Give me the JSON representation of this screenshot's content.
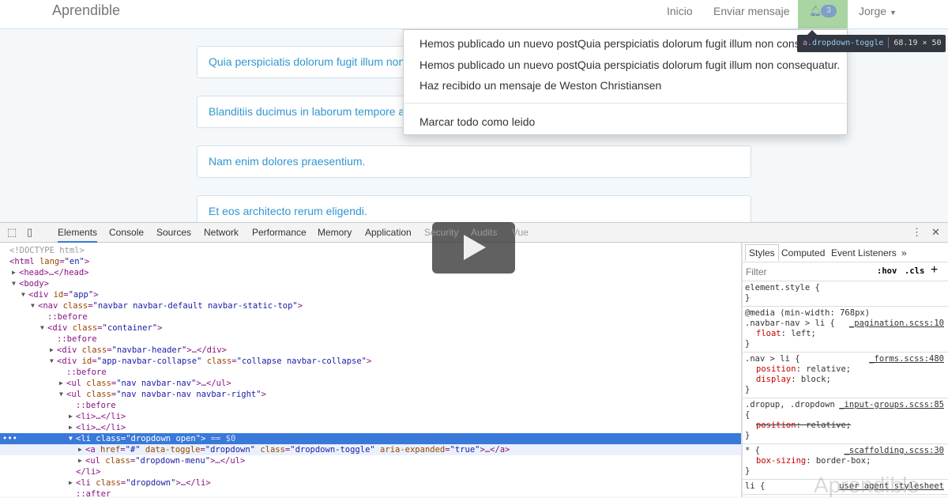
{
  "navbar": {
    "brand": "Aprendible",
    "links": [
      "Inicio",
      "Enviar mensaje"
    ],
    "notification_count": "3",
    "user": "Jorge"
  },
  "cards": [
    "Quia perspiciatis dolorum fugit illum non",
    "Blanditiis ducimus in laborum tempore au",
    "Nam enim dolores praesentium.",
    "Et eos architecto rerum eligendi."
  ],
  "dropdown": {
    "items": [
      "Hemos publicado un nuevo postQuia perspiciatis dolorum fugit illum non consequatur.",
      "Hemos publicado un nuevo postQuia perspiciatis dolorum fugit illum non consequatur.",
      "Haz recibido un mensaje de Weston Christiansen"
    ],
    "mark_all": "Marcar todo como leido"
  },
  "tooltip": {
    "tag": "a",
    "class": ".dropdown-toggle",
    "size": "68.19 × 50"
  },
  "devtools": {
    "tabs": [
      "Elements",
      "Console",
      "Sources",
      "Network",
      "Performance",
      "Memory",
      "Application",
      "Security",
      "Audits",
      "Vue"
    ],
    "lines": [
      {
        "d": 0,
        "a": "",
        "t": "<!DOCTYPE html>",
        "g": true
      },
      {
        "d": 0,
        "a": "",
        "t": "<html lang=\"en\">"
      },
      {
        "d": 1,
        "a": "▶",
        "t": "<head>…</head>"
      },
      {
        "d": 1,
        "a": "▼",
        "t": "<body>"
      },
      {
        "d": 2,
        "a": "▼",
        "t": "<div id=\"app\">"
      },
      {
        "d": 3,
        "a": "▼",
        "t": "<nav class=\"navbar navbar-default navbar-static-top\">"
      },
      {
        "d": 4,
        "a": "",
        "t": "::before"
      },
      {
        "d": 4,
        "a": "▼",
        "t": "<div class=\"container\">"
      },
      {
        "d": 5,
        "a": "",
        "t": "::before"
      },
      {
        "d": 5,
        "a": "▶",
        "t": "<div class=\"navbar-header\">…</div>"
      },
      {
        "d": 5,
        "a": "▼",
        "t": "<div id=\"app-navbar-collapse\" class=\"collapse navbar-collapse\">"
      },
      {
        "d": 6,
        "a": "",
        "t": "::before"
      },
      {
        "d": 6,
        "a": "▶",
        "t": "<ul class=\"nav navbar-nav\">…</ul>"
      },
      {
        "d": 6,
        "a": "▼",
        "t": "<ul class=\"nav navbar-nav navbar-right\">"
      },
      {
        "d": 7,
        "a": "",
        "t": "::before"
      },
      {
        "d": 7,
        "a": "▶",
        "t": "<li>…</li>"
      },
      {
        "d": 7,
        "a": "▶",
        "t": "<li>…</li>"
      },
      {
        "d": 7,
        "a": "▼",
        "t": "<li class=\"dropdown open\">",
        "extra": " == $0",
        "sel": true
      },
      {
        "d": 8,
        "a": "▶",
        "t": "<a href=\"#\" data-toggle=\"dropdown\" class=\"dropdown-toggle\" aria-expanded=\"true\">…</a>",
        "hov": true
      },
      {
        "d": 8,
        "a": "▶",
        "t": "<ul class=\"dropdown-menu\">…</ul>"
      },
      {
        "d": 7,
        "a": "",
        "t": "</li>"
      },
      {
        "d": 7,
        "a": "▶",
        "t": "<li class=\"dropdown\">…</li>"
      },
      {
        "d": 7,
        "a": "",
        "t": "::after"
      }
    ],
    "styles": {
      "tabs": [
        "Styles",
        "Computed",
        "Event Listeners",
        "»"
      ],
      "filter": "Filter",
      "hov": ":hov",
      "cls": ".cls",
      "add": "+",
      "rules": [
        {
          "sel": "element.style {",
          "src": "",
          "props": [],
          "close": "}"
        },
        {
          "pre": "@media (min-width: 768px)",
          "sel": ".navbar-nav > li {",
          "src": "_pagination.scss:10",
          "props": [
            [
              "float",
              "left"
            ]
          ],
          "close": "}"
        },
        {
          "sel": ".nav > li {",
          "src": "_forms.scss:480",
          "props": [
            [
              "position",
              "relative"
            ],
            [
              "display",
              "block"
            ]
          ],
          "close": "}"
        },
        {
          "sel": ".dropup, .dropdown",
          "src": "_input-groups.scss:85",
          "sel2": "{",
          "props": [
            [
              "position",
              "relative",
              "strike"
            ]
          ],
          "close": "}"
        },
        {
          "sel": "* {",
          "src": "_scaffolding.scss:30",
          "props": [
            [
              "box-sizing",
              "border-box"
            ]
          ],
          "close": "}"
        },
        {
          "sel": "li {",
          "src": "user agent stylesheet",
          "props": [],
          "close": ""
        }
      ]
    }
  },
  "watermark": "Aprendible"
}
